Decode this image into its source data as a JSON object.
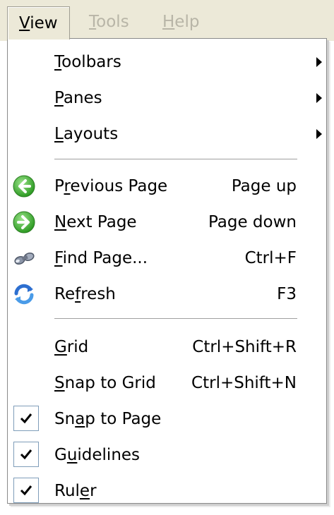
{
  "menubar": {
    "items": [
      {
        "label": "View",
        "accel": "V",
        "state": "open"
      },
      {
        "label": "Tools",
        "accel": "T",
        "state": "disabled"
      },
      {
        "label": "Help",
        "accel": "H",
        "state": "disabled"
      }
    ]
  },
  "menu": {
    "submenus": [
      {
        "label_pre": "",
        "accel": "T",
        "label_post": "oolbars"
      },
      {
        "label_pre": "",
        "accel": "P",
        "label_post": "anes"
      },
      {
        "label_pre": "",
        "accel": "L",
        "label_post": "ayouts"
      }
    ],
    "navigation": [
      {
        "label_pre": "P",
        "accel": "r",
        "label_post": "evious Page",
        "shortcut": "Page up",
        "icon": "back-arrow-icon"
      },
      {
        "label_pre": "",
        "accel": "N",
        "label_post": "ext Page",
        "shortcut": "Page down",
        "icon": "forward-arrow-icon"
      },
      {
        "label_pre": "",
        "accel": "F",
        "label_post": "ind Page...",
        "shortcut": "Ctrl+F",
        "icon": "binoculars-icon"
      },
      {
        "label_pre": "Re",
        "accel": "f",
        "label_post": "resh",
        "shortcut": "F3",
        "icon": "refresh-icon"
      }
    ],
    "layout_options": [
      {
        "label_pre": "",
        "accel": "G",
        "label_post": "rid",
        "shortcut": "Ctrl+Shift+R",
        "checked": false
      },
      {
        "label_pre": "",
        "accel": "S",
        "label_post": "nap to Grid",
        "shortcut": "Ctrl+Shift+N",
        "checked": false
      },
      {
        "label_pre": "Sn",
        "accel": "a",
        "label_post": "p to Page",
        "shortcut": "",
        "checked": true
      },
      {
        "label_pre": "G",
        "accel": "u",
        "label_post": "idelines",
        "shortcut": "",
        "checked": true
      },
      {
        "label_pre": "Rul",
        "accel": "e",
        "label_post": "r",
        "shortcut": "",
        "checked": true
      }
    ]
  },
  "colors": {
    "menubar_bg": "#ece9d8",
    "disabled_text": "#b8b5a7",
    "icon_green": "#3aa82c",
    "icon_blue": "#2d6fd0",
    "check_border": "#7f9db9"
  }
}
